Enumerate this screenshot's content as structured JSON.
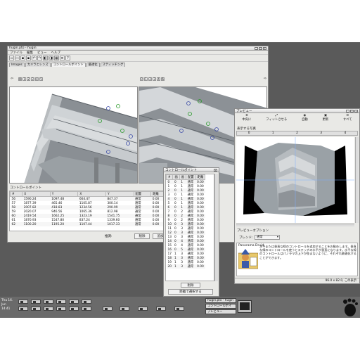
{
  "main_window": {
    "title": "hugin.pto - hugin",
    "menus": [
      "ファイル",
      "編集",
      "ビュー",
      "ヘルプ"
    ],
    "tabs": [
      "Images",
      "カメラとレンズ",
      "コントロールポイント",
      "最適化",
      "スティッチング"
    ],
    "active_tab": "コントロールポイント",
    "left_image_numbers": [
      "0",
      "1",
      "2",
      "3",
      "4",
      "5"
    ],
    "right_image_numbers": [
      "0",
      "1",
      "2",
      "3",
      "4",
      "5"
    ],
    "cp_section_label": "コントロールポイント",
    "cp_table": {
      "headers": [
        "#",
        "X",
        "Y",
        "X",
        "Y",
        "配置",
        "距離"
      ],
      "rows": [
        [
          "56",
          "1590.24",
          "1097.48",
          "664.47",
          "847.37",
          "通常",
          "0.00"
        ],
        [
          "57",
          "1877.39",
          "465.46",
          "1105.87",
          "300.14",
          "通常",
          "0.00"
        ],
        [
          "58",
          "2007.82",
          "418.83",
          "1234.56",
          "290.99",
          "通常",
          "0.00"
        ],
        [
          "59",
          "2020.07",
          "946.56",
          "1065.36",
          "812.98",
          "通常",
          "0.00"
        ],
        [
          "60",
          "2419.54",
          "1662.25",
          "1323.19",
          "1541.75",
          "通常",
          "0.00"
        ],
        [
          "61",
          "1870.93",
          "1547.80",
          "837.24",
          "1339.60",
          "通常",
          "0.00"
        ],
        [
          "62",
          "1100.20",
          "1195.20",
          "1107.44",
          "1017.33",
          "通常",
          "0.00"
        ]
      ]
    },
    "bottom_buttons": [
      "削除",
      "追加"
    ],
    "view_label": "推測:"
  },
  "cp_list_window": {
    "title": "コントロールポイント",
    "headers": [
      "#",
      "画",
      "画",
      "配置",
      "距離"
    ],
    "rows": [
      [
        "0",
        "0",
        "1",
        "通常",
        "0.00"
      ],
      [
        "1",
        "0",
        "1",
        "通常",
        "0.00"
      ],
      [
        "2",
        "0",
        "1",
        "通常",
        "0.00"
      ],
      [
        "3",
        "0",
        "1",
        "通常",
        "0.00"
      ],
      [
        "4",
        "0",
        "1",
        "通常",
        "0.00"
      ],
      [
        "5",
        "0",
        "1",
        "通常",
        "0.00"
      ],
      [
        "6",
        "0",
        "1",
        "通常",
        "0.00"
      ],
      [
        "7",
        "0",
        "2",
        "通常",
        "0.00"
      ],
      [
        "8",
        "0",
        "2",
        "通常",
        "0.00"
      ],
      [
        "9",
        "0",
        "2",
        "通常",
        "0.00"
      ],
      [
        "10",
        "0",
        "3",
        "通常",
        "0.00"
      ],
      [
        "11",
        "0",
        "3",
        "通常",
        "0.00"
      ],
      [
        "12",
        "0",
        "3",
        "通常",
        "0.00"
      ],
      [
        "13",
        "0",
        "3",
        "通常",
        "0.00"
      ],
      [
        "14",
        "0",
        "4",
        "通常",
        "0.00"
      ],
      [
        "15",
        "0",
        "4",
        "通常",
        "0.00"
      ],
      [
        "16",
        "0",
        "5",
        "通常",
        "0.00"
      ],
      [
        "17",
        "1",
        "3",
        "通常",
        "0.00"
      ],
      [
        "18",
        "1",
        "3",
        "通常",
        "0.00"
      ],
      [
        "19",
        "1",
        "3",
        "通常",
        "0.00"
      ],
      [
        "20",
        "1",
        "3",
        "通常",
        "0.00"
      ]
    ],
    "delete_button": "削除",
    "select_by_distance_button": "距離で選択する"
  },
  "preview_window": {
    "title": "プレビュー",
    "buttons": [
      "中央に",
      "フィットさせる",
      "自動",
      "更新",
      "すべて"
    ],
    "images_label": "表示する写真",
    "image_numbers": [
      "0",
      "1",
      "2",
      "3",
      "4"
    ],
    "options_label": "プレビューオプション",
    "blend_label": "ブレンド:",
    "blend_value": "通常",
    "druid_title": "Panorama Druid",
    "druid_text": "水平または垂直な線のコントロールを追加することをお勧めします。垂直な線のコントロールを使うとステッチの水平が垂直になります。水平な線のコントロールはパノラマの上下が歪まないように、それぞれ最適化することができます。",
    "status": "96.0 x 82.0, この表示"
  },
  "taskbar": {
    "date": "Thu 16. Jun",
    "time": "14:41",
    "tasks": [
      "hugin.pto - hugin",
      "コントロールポイ",
      "プレビュー"
    ]
  }
}
